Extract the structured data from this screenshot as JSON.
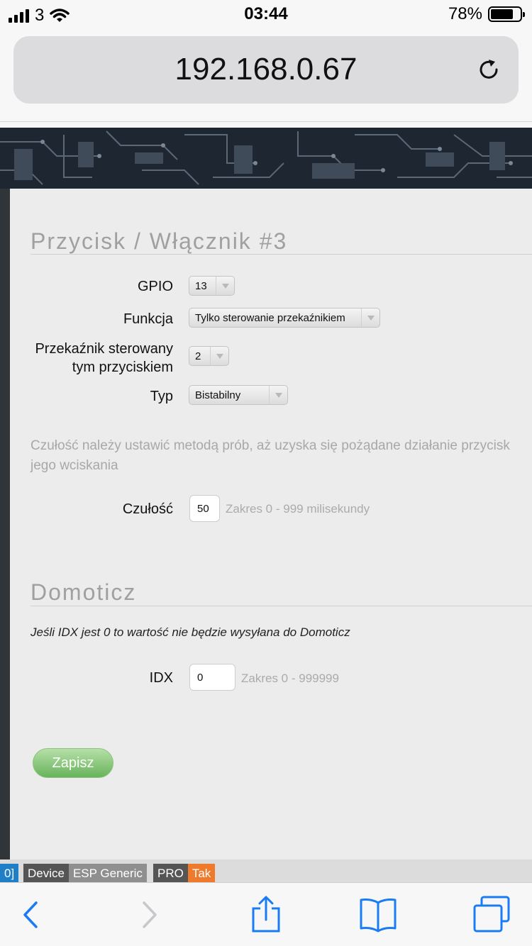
{
  "status_bar": {
    "carrier": "3",
    "time": "03:44",
    "battery": "78%",
    "battery_level": 0.78
  },
  "browser": {
    "url": "192.168.0.67"
  },
  "button_section": {
    "title": "Przycisk / Włącznik #3",
    "gpio_label": "GPIO",
    "gpio_value": "13",
    "funkcja_label": "Funkcja",
    "funkcja_value": "Tylko sterowanie przekaźnikiem",
    "relay_label_line1": "Przekaźnik sterowany",
    "relay_label_line2": "tym przyciskiem",
    "relay_value": "2",
    "typ_label": "Typ",
    "typ_value": "Bistabilny",
    "sensitivity_hint_line1": "Czułość należy ustawić metodą prób, aż uzyska się pożądane działanie przycisk",
    "sensitivity_hint_line2": "jego wciskania",
    "czulosc_label": "Czułość",
    "czulosc_value": "50",
    "czulosc_range": "Zakres 0 - 999 milisekundy"
  },
  "domoticz_section": {
    "title": "Domoticz",
    "note": "Jeśli IDX jest 0 to wartość nie będzie wysyłana do Domoticz",
    "idx_label": "IDX",
    "idx_value": "0",
    "idx_range": "Zakres 0 - 999999"
  },
  "save_button": "Zapisz",
  "footer_tags": {
    "first": "0]",
    "device_key": "Device",
    "device_value": "ESP Generic",
    "pro_key": "PRO",
    "pro_value": "Tak"
  },
  "colors": {
    "save_button": "#68b35b",
    "tag_dark": "#555555",
    "tag_grey": "#8f8f8f",
    "tag_orange": "#f07a2b",
    "tag_blue": "#1f7fc6",
    "ios_blue": "#1a7cf3"
  },
  "icons": [
    "signal-icon",
    "wifi-icon",
    "battery-icon",
    "reload-icon",
    "back-icon",
    "forward-icon",
    "share-icon",
    "bookmarks-icon",
    "tabs-icon"
  ]
}
